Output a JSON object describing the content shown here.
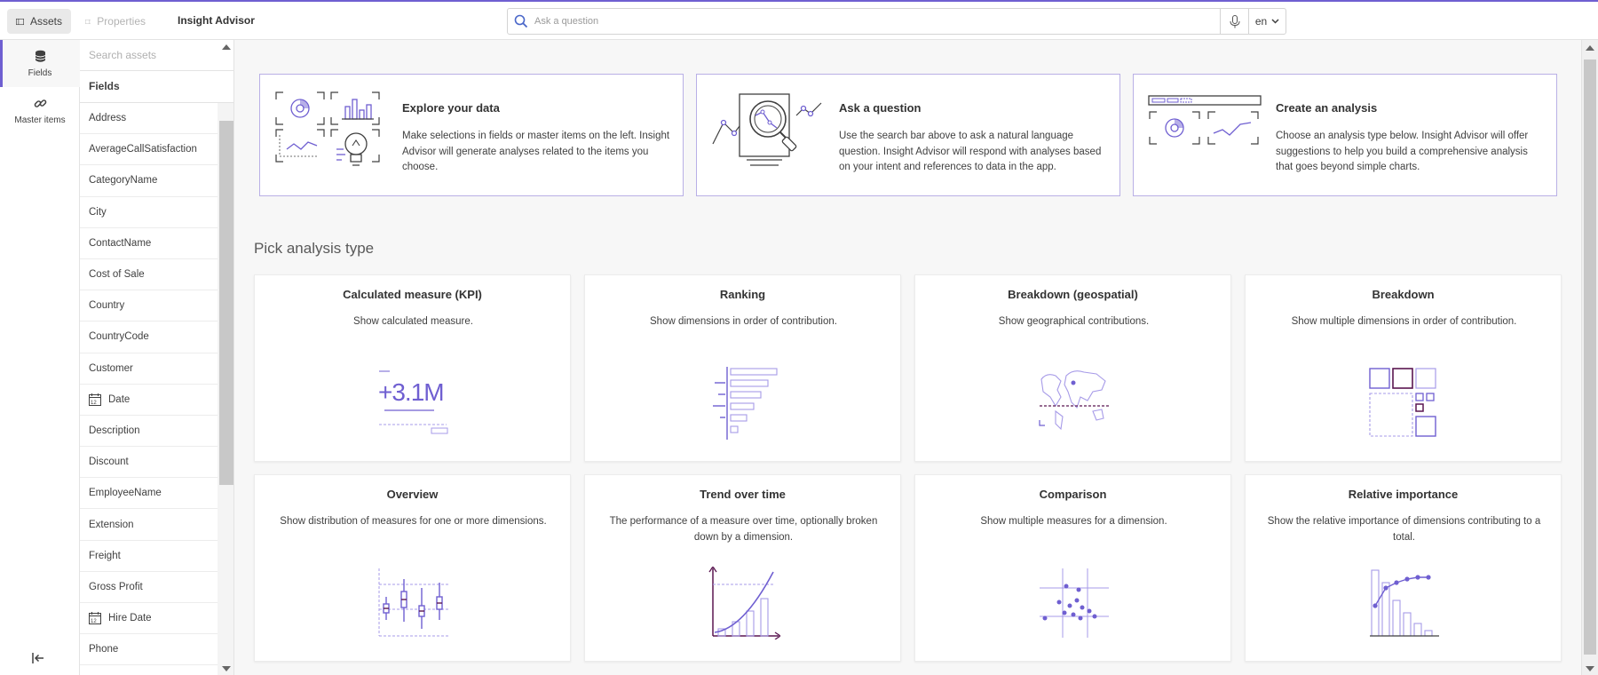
{
  "topbar": {
    "assets_label": "Assets",
    "properties_label": "Properties",
    "title": "Insight Advisor",
    "search_placeholder": "Ask a question",
    "language": "en"
  },
  "rail": {
    "items": [
      {
        "label": "Fields",
        "icon": "database-icon",
        "active": true
      },
      {
        "label": "Master items",
        "icon": "link-icon",
        "active": false
      }
    ]
  },
  "assets": {
    "search_placeholder": "Search assets",
    "header": "Fields",
    "fields": [
      {
        "label": "Address",
        "icon": ""
      },
      {
        "label": "AverageCallSatisfaction",
        "icon": ""
      },
      {
        "label": "CategoryName",
        "icon": ""
      },
      {
        "label": "City",
        "icon": ""
      },
      {
        "label": "ContactName",
        "icon": ""
      },
      {
        "label": "Cost of Sale",
        "icon": ""
      },
      {
        "label": "Country",
        "icon": ""
      },
      {
        "label": "CountryCode",
        "icon": ""
      },
      {
        "label": "Customer",
        "icon": ""
      },
      {
        "label": "Date",
        "icon": "calendar-icon"
      },
      {
        "label": "Description",
        "icon": ""
      },
      {
        "label": "Discount",
        "icon": ""
      },
      {
        "label": "EmployeeName",
        "icon": ""
      },
      {
        "label": "Extension",
        "icon": ""
      },
      {
        "label": "Freight",
        "icon": ""
      },
      {
        "label": "Gross Profit",
        "icon": ""
      },
      {
        "label": "Hire Date",
        "icon": "calendar-icon"
      },
      {
        "label": "Phone",
        "icon": ""
      }
    ]
  },
  "intro_cards": [
    {
      "title": "Explore your data",
      "desc": "Make selections in fields or master items on the left. Insight Advisor will generate analyses related to the items you choose."
    },
    {
      "title": "Ask a question",
      "desc": "Use the search bar above to ask a natural language question. Insight Advisor will respond with analyses based on your intent and references to data in the app."
    },
    {
      "title": "Create an analysis",
      "desc": "Choose an analysis type below. Insight Advisor will offer suggestions to help you build a comprehensive analysis that goes beyond simple charts."
    }
  ],
  "section_title": "Pick analysis type",
  "analysis_types": [
    {
      "title": "Calculated measure (KPI)",
      "desc": "Show calculated measure.",
      "kpi_value": "+3.1M"
    },
    {
      "title": "Ranking",
      "desc": "Show dimensions in order of contribution."
    },
    {
      "title": "Breakdown (geospatial)",
      "desc": "Show geographical contributions."
    },
    {
      "title": "Breakdown",
      "desc": "Show multiple dimensions in order of contribution."
    },
    {
      "title": "Overview",
      "desc": "Show distribution of measures for one or more dimensions."
    },
    {
      "title": "Trend over time",
      "desc": "The performance of a measure over time, optionally broken down by a dimension."
    },
    {
      "title": "Comparison",
      "desc": "Show multiple measures for a dimension."
    },
    {
      "title": "Relative importance",
      "desc": "Show the relative importance of dimensions contributing to a total."
    }
  ],
  "colors": {
    "accent": "#6f5fd1",
    "accent_light": "#a79be8",
    "dark_accent": "#5a1650"
  }
}
